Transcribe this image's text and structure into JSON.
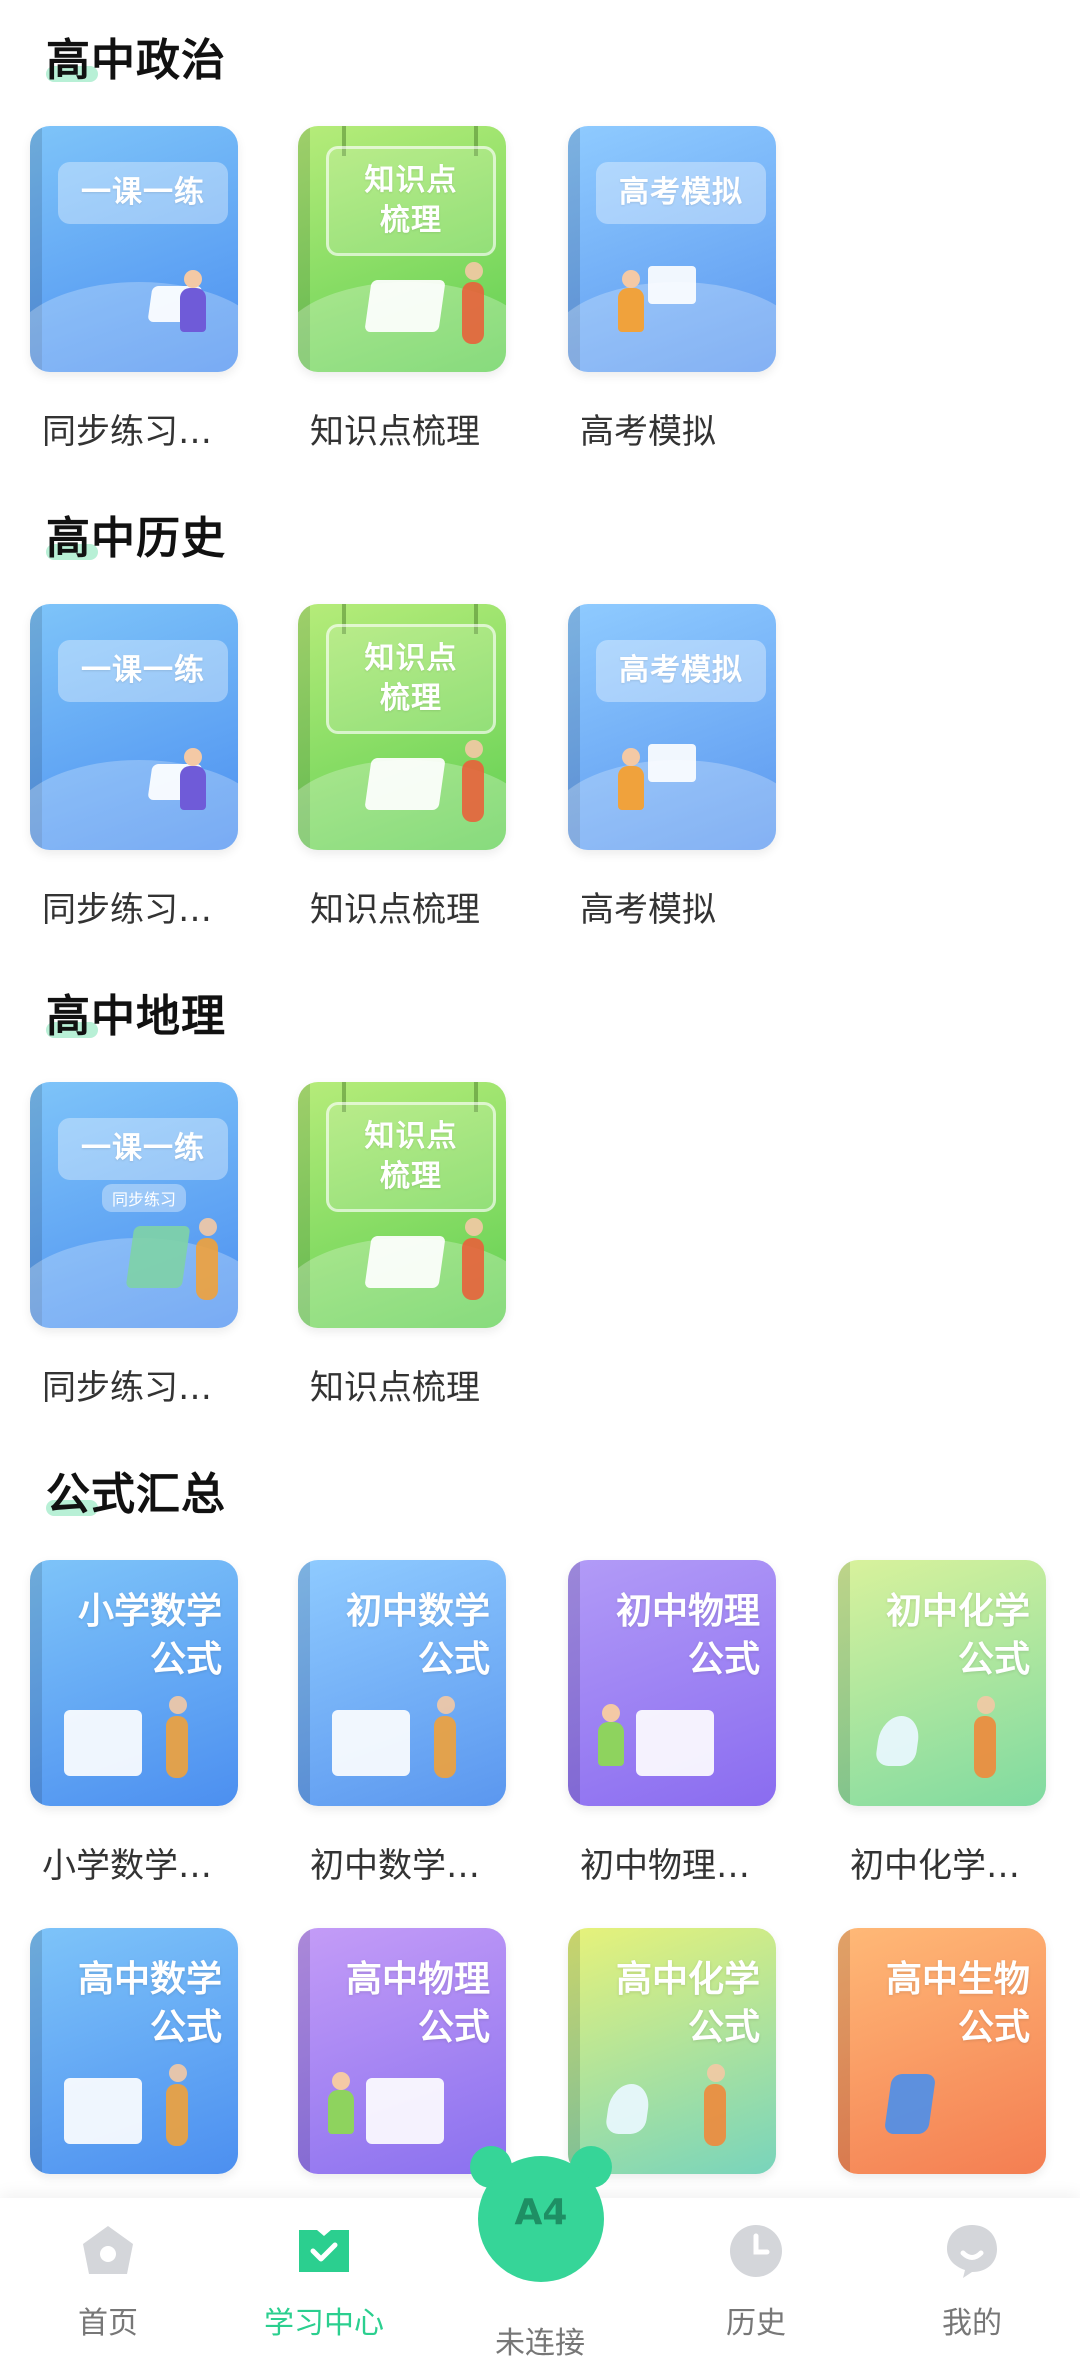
{
  "sections": [
    {
      "title": "高中政治",
      "cards": [
        {
          "title": "同步练习…",
          "cover": "一课一练",
          "style": "practice"
        },
        {
          "title": "知识点梳理",
          "cover_line1": "知识点",
          "cover_line2": "梳理",
          "style": "knowledge"
        },
        {
          "title": "高考模拟",
          "cover": "高考模拟",
          "style": "exam"
        }
      ]
    },
    {
      "title": "高中历史",
      "cards": [
        {
          "title": "同步练习…",
          "cover": "一课一练",
          "style": "practice"
        },
        {
          "title": "知识点梳理",
          "cover_line1": "知识点",
          "cover_line2": "梳理",
          "style": "knowledge"
        },
        {
          "title": "高考模拟",
          "cover": "高考模拟",
          "style": "exam"
        }
      ]
    },
    {
      "title": "高中地理",
      "cards": [
        {
          "title": "同步练习…",
          "cover": "一课一练",
          "cover_sub": "同步练习",
          "style": "practice"
        },
        {
          "title": "知识点梳理",
          "cover_line1": "知识点",
          "cover_line2": "梳理",
          "style": "knowledge"
        }
      ]
    },
    {
      "title": "公式汇总",
      "cards": [
        {
          "title": "小学数学…",
          "cover_line1": "小学数学",
          "cover_line2": "公式",
          "theme": "#5b97ef"
        },
        {
          "title": "初中数学…",
          "cover_line1": "初中数学",
          "cover_line2": "公式",
          "theme": "#5b97ef"
        },
        {
          "title": "初中物理…",
          "cover_line1": "初中物理",
          "cover_line2": "公式",
          "theme": "#8a6cf0"
        },
        {
          "title": "初中化学…",
          "cover_line1": "初中化学",
          "cover_line2": "公式",
          "theme": "#7fdaa1"
        },
        {
          "title": "",
          "cover_line1": "高中数学",
          "cover_line2": "公式",
          "theme": "#5b97ef"
        },
        {
          "title": "",
          "cover_line1": "高中物理",
          "cover_line2": "公式",
          "theme": "#8a71ef"
        },
        {
          "title": "",
          "cover_line1": "高中化学",
          "cover_line2": "公式",
          "theme": "#78d4bc"
        },
        {
          "title": "",
          "cover_line1": "高中生物",
          "cover_line2": "公式",
          "theme": "#f47e52"
        }
      ]
    }
  ],
  "bottom_nav": {
    "items": [
      {
        "label": "首页",
        "icon": "home-icon"
      },
      {
        "label": "学习中心",
        "icon": "study-center-icon",
        "active": true
      },
      {
        "label": "未连接",
        "icon": "a4-device-icon",
        "center_text": "A4"
      },
      {
        "label": "历史",
        "icon": "clock-icon"
      },
      {
        "label": "我的",
        "icon": "profile-icon"
      }
    ],
    "active_color": "#2bcf8f",
    "center_color": "#36d598"
  }
}
